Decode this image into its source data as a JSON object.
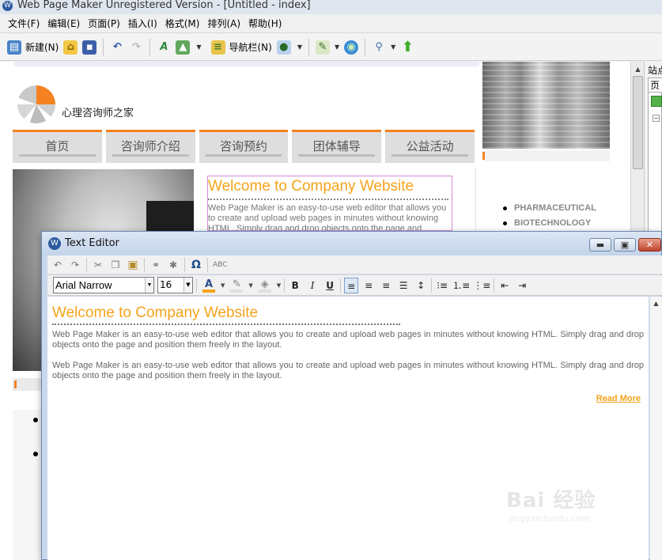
{
  "app": {
    "title": "Web Page Maker Unregistered Version - [Untitled - index]",
    "icon_glyph": "W"
  },
  "menu": [
    {
      "label": "文件(F)",
      "name": "menu-file"
    },
    {
      "label": "编辑(E)",
      "name": "menu-edit"
    },
    {
      "label": "页面(P)",
      "name": "menu-page"
    },
    {
      "label": "插入(I)",
      "name": "menu-insert"
    },
    {
      "label": "格式(M)",
      "name": "menu-format"
    },
    {
      "label": "排列(A)",
      "name": "menu-arrange"
    },
    {
      "label": "帮助(H)",
      "name": "menu-help"
    }
  ],
  "toolbar": {
    "new_label": "新建(N)",
    "navbar_label": "导航栏(N)"
  },
  "site": {
    "logo_text": "心理咨询师之家",
    "nav_tabs": [
      "首页",
      "咨询师介绍",
      "咨询预约",
      "团体辅导",
      "公益活动"
    ],
    "welcome_title": "Welcome to Company Website",
    "welcome_body": "Web Page Maker is an easy-to-use web editor that allows you to create and upload web pages in minutes without knowing HTML. Simply drag and drop objects onto the page and position them freely in the layout.",
    "sidebar_items": [
      "PHARMACEUTICAL",
      "BIOTECHNOLOGY"
    ]
  },
  "site_panel": {
    "title": "站点",
    "tab": "页"
  },
  "editor": {
    "title": "Text Editor",
    "font": "Arial Narrow",
    "size": "16",
    "content_title": "Welcome to Company Website",
    "para1": "Web Page Maker is an easy-to-use web editor that allows you to create and upload web pages in minutes without knowing HTML. Simply drag and drop objects onto the page and position them freely in the layout.",
    "para2": "Web Page Maker is an easy-to-use web editor that allows you to create and upload web pages in minutes without knowing HTML. Simply drag and drop objects onto the page and position them freely in the layout.",
    "read_more": "Read More",
    "btn_minimize": "▬",
    "btn_restore": "▣",
    "btn_close": "✕"
  },
  "watermark": {
    "main": "Bai 经验",
    "sub": "jingyan.baidu.com"
  },
  "colors": {
    "accent_orange": "#f5a31a",
    "nav_border": "#f58220",
    "brand_blue": "#2d5a9e"
  }
}
